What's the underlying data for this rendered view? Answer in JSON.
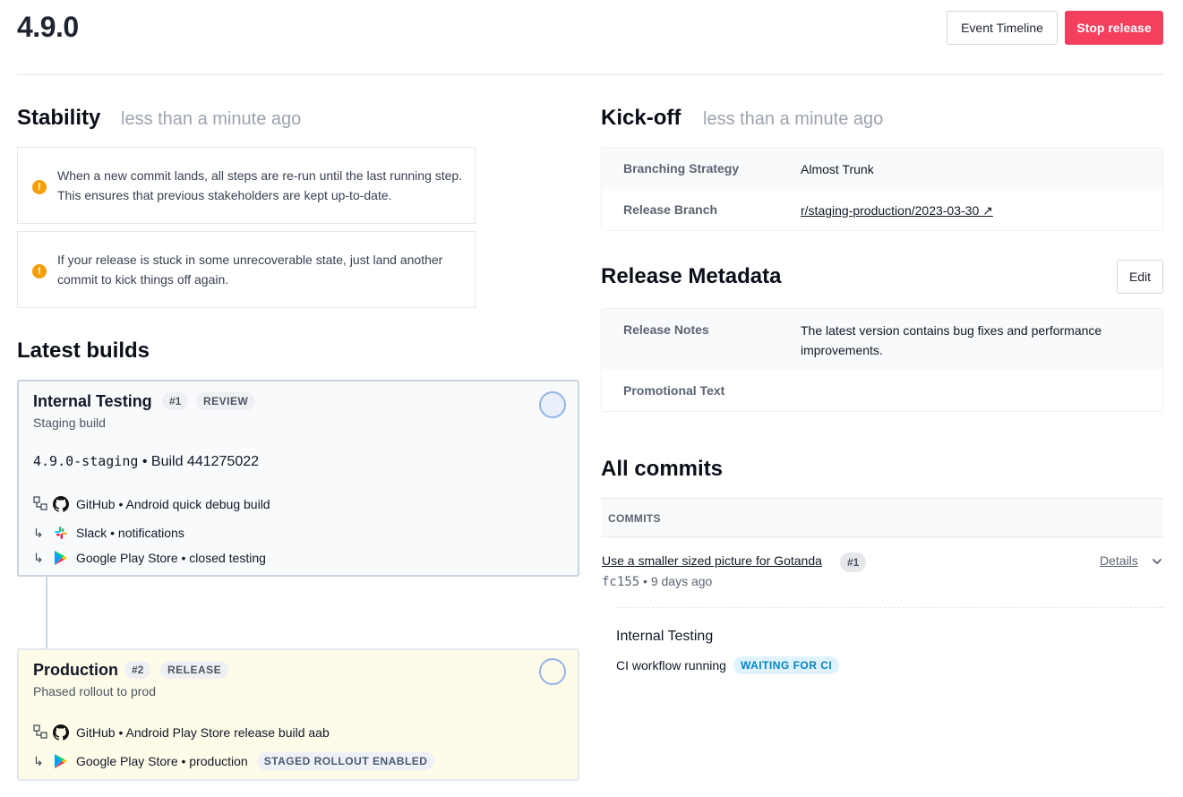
{
  "header": {
    "version": "4.9.0",
    "event_timeline_label": "Event Timeline",
    "stop_release_label": "Stop release"
  },
  "stability": {
    "title": "Stability",
    "time": "less than a minute ago",
    "notices": [
      "When a new commit lands, all steps are re-run until the last running step. This ensures that previous stakeholders are kept up-to-date.",
      "If your release is stuck in some unrecoverable state, just land another commit to kick things off again."
    ]
  },
  "latest_builds": {
    "title": "Latest builds",
    "builds": [
      {
        "name": "Internal Testing",
        "number": "#1",
        "tag": "REVIEW",
        "subtitle": "Staging build",
        "version": "4.9.0-staging",
        "build_label": "• Build 441275022",
        "steps": [
          {
            "text": "GitHub • Android quick debug build"
          },
          {
            "text": "Slack • notifications"
          },
          {
            "text": "Google Play Store • closed testing"
          }
        ]
      },
      {
        "name": "Production",
        "number": "#2",
        "tag": "RELEASE",
        "subtitle": "Phased rollout to prod",
        "steps": [
          {
            "text": "GitHub • Android Play Store release build aab"
          },
          {
            "text": "Google Play Store • production",
            "badge": "STAGED ROLLOUT ENABLED"
          }
        ]
      }
    ]
  },
  "kickoff": {
    "title": "Kick-off",
    "time": "less than a minute ago",
    "rows": [
      {
        "key": "Branching Strategy",
        "value": "Almost Trunk"
      },
      {
        "key": "Release Branch",
        "value": "r/staging-production/2023-03-30 ↗"
      }
    ]
  },
  "metadata": {
    "title": "Release Metadata",
    "edit_label": "Edit",
    "rows": [
      {
        "key": "Release Notes",
        "value": "The latest version contains bug fixes and performance improvements."
      },
      {
        "key": "Promotional Text",
        "value": ""
      }
    ]
  },
  "commits": {
    "title": "All commits",
    "column_header": "COMMITS",
    "items": [
      {
        "title": "Use a smaller sized picture for Gotanda",
        "number": "#1",
        "sha": "fc155",
        "age": "• 9 days ago",
        "details_label": "Details",
        "stage": {
          "name": "Internal Testing",
          "status_text": "CI workflow running",
          "status_badge": "WAITING FOR CI"
        }
      }
    ]
  },
  "colors": {
    "danger": "#f43f5e",
    "warning": "#f59e0b",
    "info_badge": "#0284c7",
    "production_bg": "#fefbe8"
  }
}
